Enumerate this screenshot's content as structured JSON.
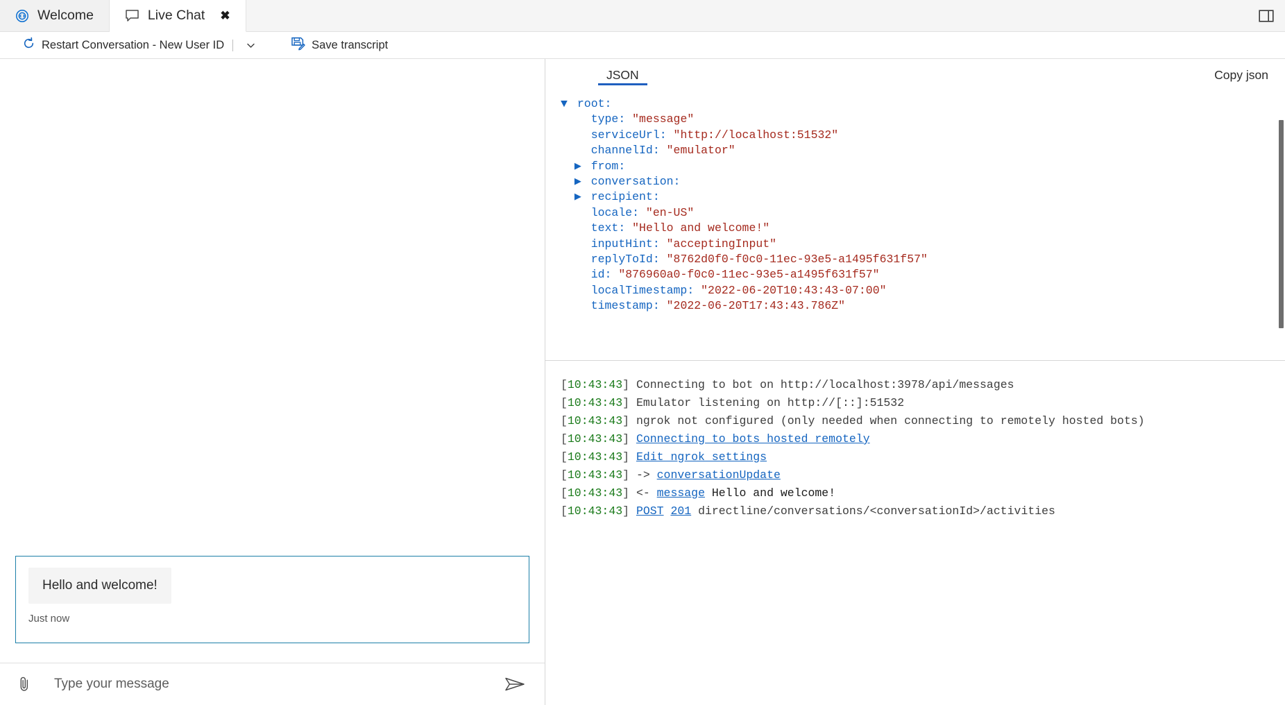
{
  "tabs": [
    {
      "label": "Welcome",
      "icon": "welcome-target-icon",
      "active": false,
      "closable": false
    },
    {
      "label": "Live Chat",
      "icon": "chat-bubble-icon",
      "active": true,
      "closable": true
    }
  ],
  "window": {
    "layout_toggle_icon": "panel-layout-icon"
  },
  "toolbar": {
    "restart_label": "Restart Conversation - New User ID",
    "restart_icon": "restart-circular-arrow-icon",
    "restart_caret_icon": "chevron-down-icon",
    "save_transcript_label": "Save transcript",
    "save_transcript_icon": "save-disk-pencil-icon"
  },
  "chat": {
    "message": {
      "text": "Hello and welcome!",
      "timestamp_label": "Just now"
    },
    "composer": {
      "placeholder": "Type your message",
      "value": "",
      "attach_icon": "paperclip-icon",
      "send_icon": "send-paper-plane-icon"
    }
  },
  "inspector": {
    "tabs": [
      {
        "label": "JSON",
        "active": true
      }
    ],
    "copy_json_label": "Copy json",
    "json": {
      "root_label": "root",
      "root_expanded": true,
      "entries": [
        {
          "indent": 0,
          "toggle": "down",
          "key": "root",
          "value": null,
          "type": "object"
        },
        {
          "indent": 1,
          "toggle": "none",
          "key": "type",
          "value": "\"message\"",
          "type": "string"
        },
        {
          "indent": 1,
          "toggle": "none",
          "key": "serviceUrl",
          "value": "\"http://localhost:51532\"",
          "type": "string"
        },
        {
          "indent": 1,
          "toggle": "none",
          "key": "channelId",
          "value": "\"emulator\"",
          "type": "string"
        },
        {
          "indent": 1,
          "toggle": "right",
          "key": "from",
          "value": null,
          "type": "object"
        },
        {
          "indent": 1,
          "toggle": "right",
          "key": "conversation",
          "value": null,
          "type": "object"
        },
        {
          "indent": 1,
          "toggle": "right",
          "key": "recipient",
          "value": null,
          "type": "object"
        },
        {
          "indent": 1,
          "toggle": "none",
          "key": "locale",
          "value": "\"en-US\"",
          "type": "string"
        },
        {
          "indent": 1,
          "toggle": "none",
          "key": "text",
          "value": "\"Hello and welcome!\"",
          "type": "string"
        },
        {
          "indent": 1,
          "toggle": "none",
          "key": "inputHint",
          "value": "\"acceptingInput\"",
          "type": "string"
        },
        {
          "indent": 1,
          "toggle": "none",
          "key": "replyToId",
          "value": "\"8762d0f0-f0c0-11ec-93e5-a1495f631f57\"",
          "type": "string"
        },
        {
          "indent": 1,
          "toggle": "none",
          "key": "id",
          "value": "\"876960a0-f0c0-11ec-93e5-a1495f631f57\"",
          "type": "string"
        },
        {
          "indent": 1,
          "toggle": "none",
          "key": "localTimestamp",
          "value": "\"2022-06-20T10:43:43-07:00\"",
          "type": "string"
        },
        {
          "indent": 1,
          "toggle": "none",
          "key": "timestamp",
          "value": "\"2022-06-20T17:43:43.786Z\"",
          "type": "string"
        }
      ]
    },
    "log": {
      "lines": [
        {
          "time": "10:43:43",
          "parts": [
            {
              "t": "text",
              "v": "Connecting to bot on http://localhost:3978/api/messages"
            }
          ]
        },
        {
          "time": "10:43:43",
          "parts": [
            {
              "t": "text",
              "v": "Emulator listening on http://[::]:51532"
            }
          ]
        },
        {
          "time": "10:43:43",
          "parts": [
            {
              "t": "text",
              "v": "ngrok not configured (only needed when connecting to remotely hosted bots)"
            }
          ]
        },
        {
          "time": "10:43:43",
          "parts": [
            {
              "t": "link",
              "v": "Connecting to bots hosted remotely"
            }
          ]
        },
        {
          "time": "10:43:43",
          "parts": [
            {
              "t": "link",
              "v": "Edit ngrok settings"
            }
          ]
        },
        {
          "time": "10:43:43",
          "parts": [
            {
              "t": "text",
              "v": "-> "
            },
            {
              "t": "link",
              "v": "conversationUpdate"
            }
          ]
        },
        {
          "time": "10:43:43",
          "parts": [
            {
              "t": "text",
              "v": "<- "
            },
            {
              "t": "link",
              "v": "message"
            },
            {
              "t": "strong",
              "v": " Hello and welcome!"
            }
          ]
        },
        {
          "time": "10:43:43",
          "parts": [
            {
              "t": "link",
              "v": "POST"
            },
            {
              "t": "text",
              "v": " "
            },
            {
              "t": "link",
              "v": "201"
            },
            {
              "t": "text",
              "v": " directline/conversations/<conversationId>/activities"
            }
          ]
        }
      ]
    }
  },
  "colors": {
    "accent_blue": "#1565c0",
    "tab_underline": "#1f5fbf",
    "json_string": "#a52a1e",
    "log_timestamp_green": "#1a7a1a",
    "activity_border": "#1b7fa8",
    "bubble_bg": "#f4f4f4"
  }
}
